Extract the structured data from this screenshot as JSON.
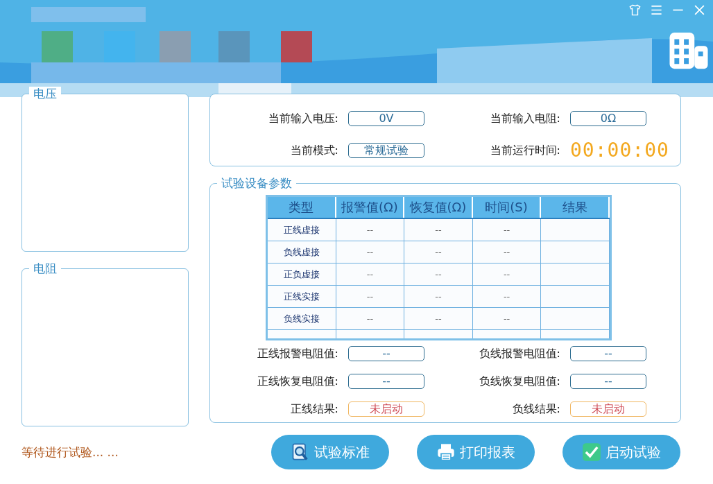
{
  "voltage_panel": {
    "title": "电压"
  },
  "resistance_panel": {
    "title": "电阻"
  },
  "status_panel": {
    "fields": [
      {
        "label": "当前输入电压:",
        "value": "0V",
        "kind": "box"
      },
      {
        "label": "当前输入电阻:",
        "value": "0Ω",
        "kind": "box"
      },
      {
        "label": "当前模式:",
        "value": "常规试验",
        "kind": "box"
      },
      {
        "label": "当前运行时间:",
        "value": "00:00:00",
        "kind": "timer"
      }
    ]
  },
  "test_params": {
    "title": "试验设备参数",
    "table": {
      "columns": [
        "类型",
        "报警值(Ω)",
        "恢复值(Ω)",
        "时间(S)",
        "结果"
      ],
      "rows": [
        [
          "正线虚接",
          "--",
          "--",
          "--",
          ""
        ],
        [
          "负线虚接",
          "--",
          "--",
          "--",
          ""
        ],
        [
          "正负虚接",
          "--",
          "--",
          "--",
          ""
        ],
        [
          "正线实接",
          "--",
          "--",
          "--",
          ""
        ],
        [
          "负线实接",
          "--",
          "--",
          "--",
          ""
        ]
      ]
    },
    "fields": [
      {
        "label": "正线报警电阻值:",
        "value": "--",
        "kind": "box"
      },
      {
        "label": "负线报警电阻值:",
        "value": "--",
        "kind": "box"
      },
      {
        "label": "正线恢复电阻值:",
        "value": "--",
        "kind": "box"
      },
      {
        "label": "负线恢复电阻值:",
        "value": "--",
        "kind": "box"
      },
      {
        "label": "正线结果:",
        "value": "未启动",
        "kind": "result"
      },
      {
        "label": "负线结果:",
        "value": "未启动",
        "kind": "result"
      }
    ]
  },
  "status_text": "等待进行试验... ...",
  "buttons": [
    {
      "label": "试验标准",
      "kind": "search"
    },
    {
      "label": "打印报表",
      "kind": "print"
    },
    {
      "label": "启动试验",
      "kind": "check"
    }
  ]
}
